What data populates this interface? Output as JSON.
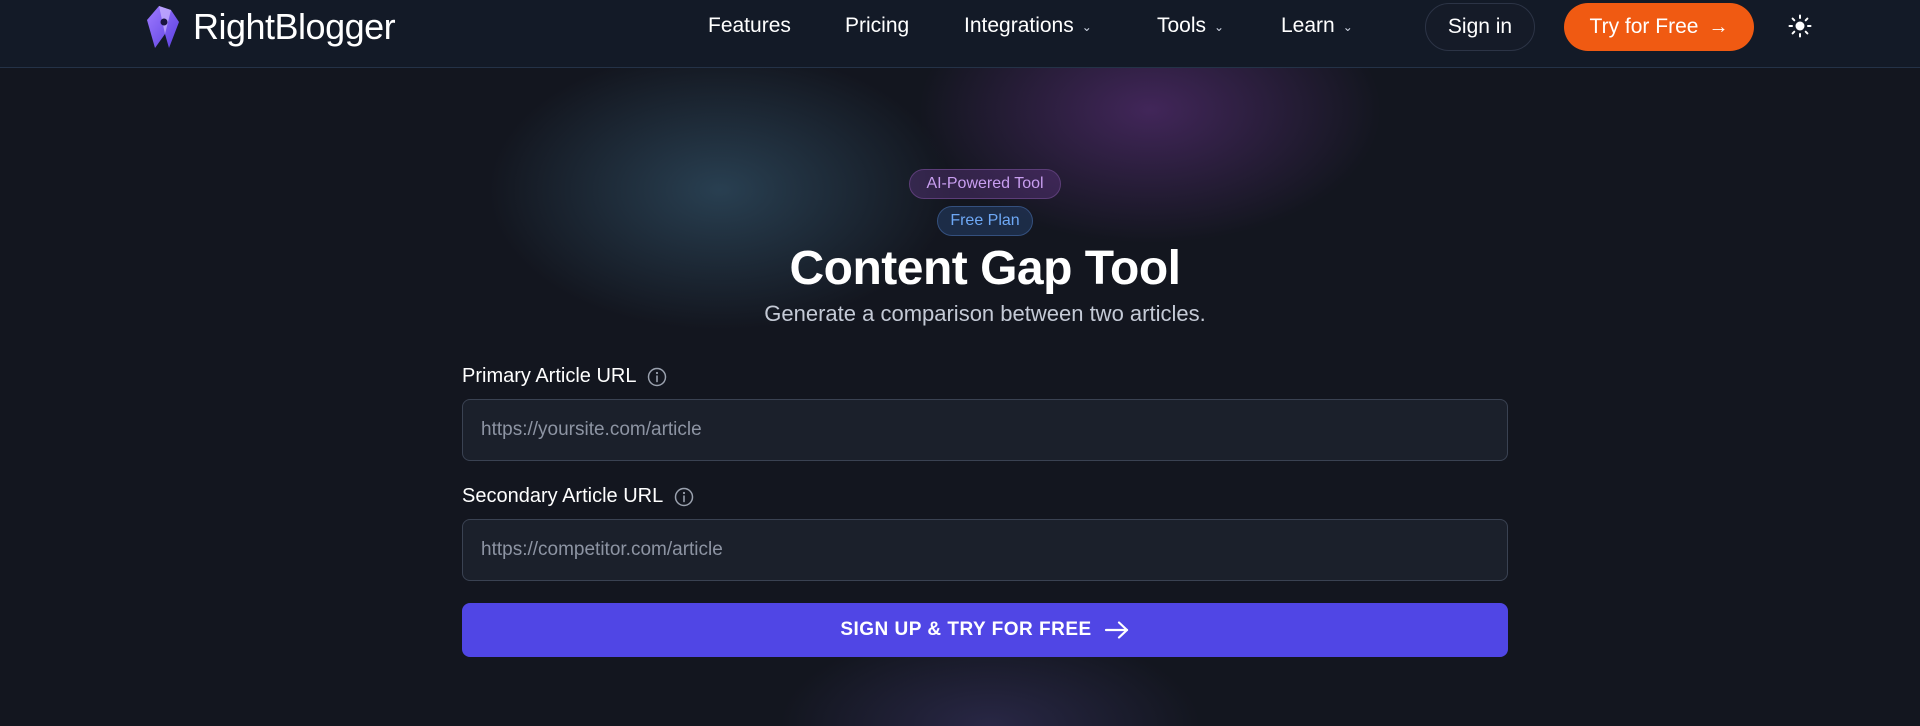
{
  "header": {
    "brand": "RightBlogger",
    "nav": [
      {
        "label": "Features",
        "has_dropdown": false
      },
      {
        "label": "Pricing",
        "has_dropdown": false
      },
      {
        "label": "Integrations",
        "has_dropdown": true
      },
      {
        "label": "Tools",
        "has_dropdown": true
      },
      {
        "label": "Learn",
        "has_dropdown": true
      }
    ],
    "sign_in_label": "Sign in",
    "try_label": "Try for Free",
    "theme_icon": "sun-icon"
  },
  "hero": {
    "badge_ai": "AI-Powered Tool",
    "badge_plan": "Free Plan",
    "title": "Content Gap Tool",
    "subtitle": "Generate a comparison between two articles."
  },
  "form": {
    "primary_label": "Primary Article URL",
    "primary_placeholder": "https://yoursite.com/article",
    "primary_value": "",
    "secondary_label": "Secondary Article URL",
    "secondary_placeholder": "https://competitor.com/article",
    "secondary_value": "",
    "submit_label": "SIGN UP & TRY FOR FREE"
  },
  "colors": {
    "background": "#13161f",
    "header_bg": "#131a27",
    "try_button": "#f05a12",
    "cta_button": "#5046e5",
    "badge_ai_text": "#c89ef0",
    "badge_plan_text": "#6ea8f5"
  }
}
